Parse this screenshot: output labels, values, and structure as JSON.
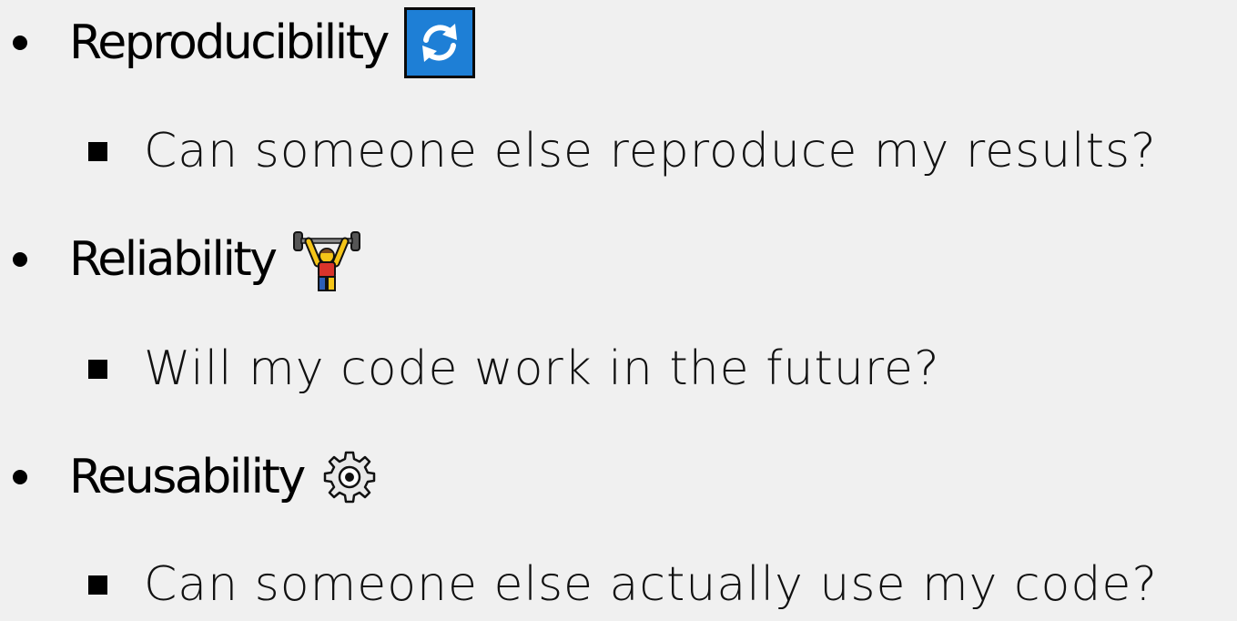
{
  "items": [
    {
      "label": "Reproducibility",
      "icon": "arrows-counterclockwise-icon",
      "sub": "Can someone else reproduce my results?"
    },
    {
      "label": "Reliability",
      "icon": "person-lifting-weights-icon",
      "sub": "Will my code work in the future?"
    },
    {
      "label": "Reusability",
      "icon": "gear-icon",
      "sub": "Can someone else actually use my code?"
    }
  ],
  "colors": {
    "background": "#f0f0f0",
    "text": "#000000",
    "refresh_icon_blue": "#1e7fd6",
    "lifter_skin": "#f5c518",
    "lifter_shirt": "#d9342b",
    "lifter_pants": "#2d5fb8"
  }
}
